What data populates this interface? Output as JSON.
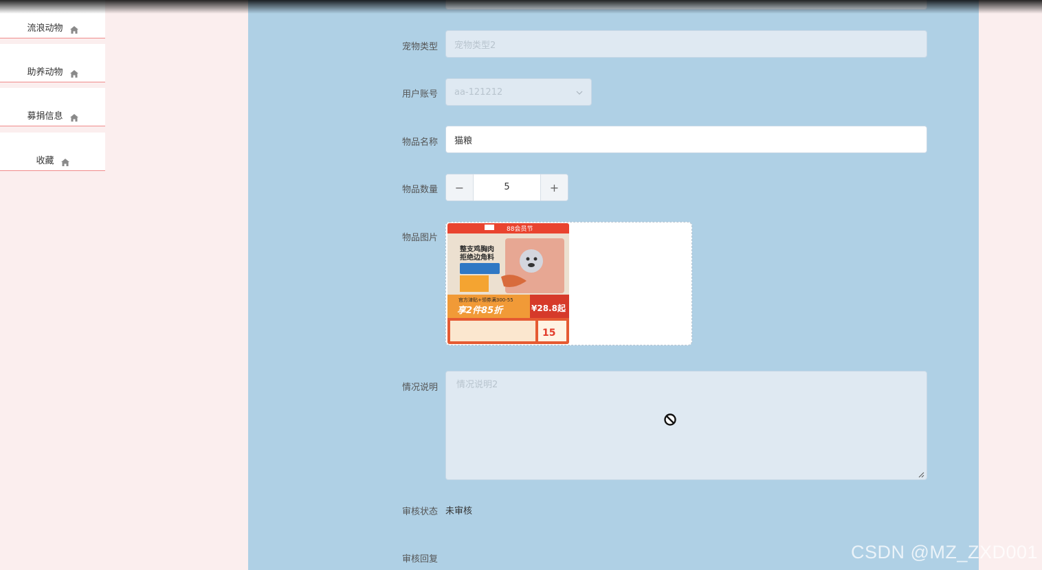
{
  "sidebar": {
    "items": [
      {
        "label": "流浪动物",
        "icon": "home-icon"
      },
      {
        "label": "助养动物",
        "icon": "home-icon"
      },
      {
        "label": "募捐信息",
        "icon": "home-icon"
      },
      {
        "label": "收藏",
        "icon": "home-icon"
      }
    ]
  },
  "form": {
    "pet_type": {
      "label": "宠物类型",
      "placeholder": "宠物类型2"
    },
    "user_account": {
      "label": "用户账号",
      "value": "aa-121212"
    },
    "item_name": {
      "label": "物品名称",
      "value": "猫粮"
    },
    "item_quantity": {
      "label": "物品数量",
      "value": "5",
      "minus": "−",
      "plus": "+"
    },
    "item_image": {
      "label": "物品图片",
      "thumb": {
        "banner": "88会员节",
        "headline1": "整支鸡胸肉",
        "headline2": "拒绝边角料",
        "promo_line": "官方津贴+领券满300-55",
        "discount": "享2件85折",
        "price": "¥28.8起",
        "coupon": "15"
      }
    },
    "description": {
      "label": "情况说明",
      "placeholder": "情况说明2"
    },
    "review_status": {
      "label": "审核状态",
      "value": "未审核"
    },
    "review_reply": {
      "label": "审核回复"
    }
  },
  "watermark": "CSDN @MZ_ZXD001",
  "colors": {
    "panel_bg": "#afd0e5",
    "page_bg": "#fbeeee",
    "sidebar_divider": "#f08a8a",
    "disabled_input": "#dfe9f2"
  }
}
